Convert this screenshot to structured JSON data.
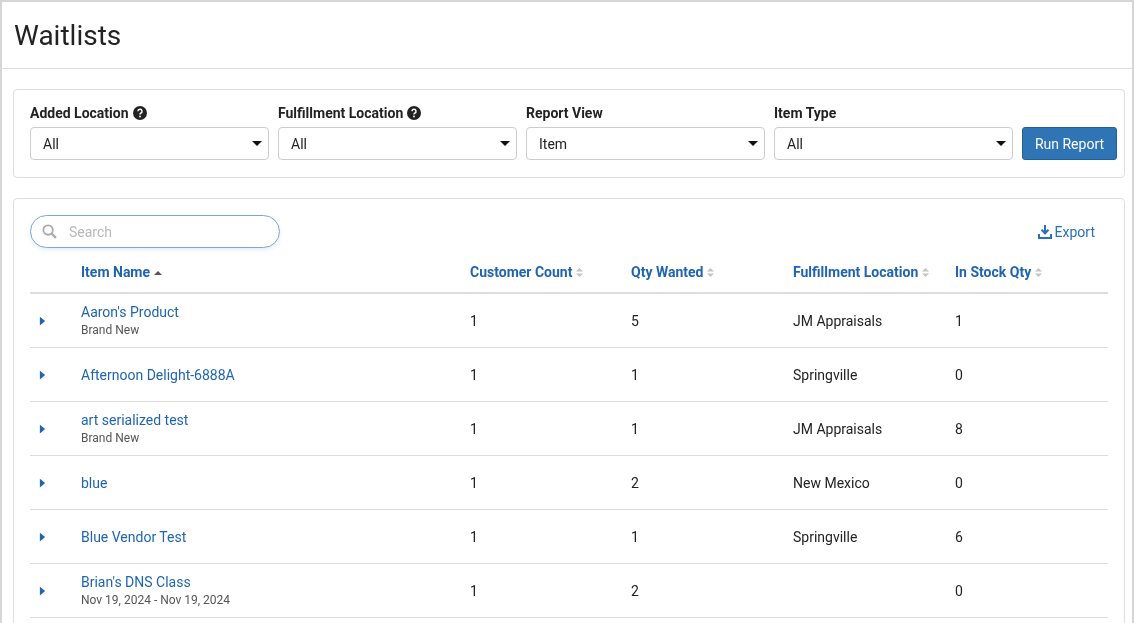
{
  "page": {
    "title": "Waitlists"
  },
  "filters": [
    {
      "label": "Added Location",
      "help": true,
      "value": "All"
    },
    {
      "label": "Fulfillment Location",
      "help": true,
      "value": "All"
    },
    {
      "label": "Report View",
      "help": false,
      "value": "Item"
    },
    {
      "label": "Item Type",
      "help": false,
      "value": "All"
    }
  ],
  "run_button": "Run Report",
  "search": {
    "placeholder": "Search"
  },
  "export": "Export",
  "table": {
    "columns": [
      {
        "label": "Item Name",
        "sorted": true
      },
      {
        "label": "Customer Count",
        "sorted": false
      },
      {
        "label": "Qty Wanted",
        "sorted": false
      },
      {
        "label": "Fulfillment Location",
        "sorted": false
      },
      {
        "label": "In Stock Qty",
        "sorted": false
      }
    ],
    "rows": [
      {
        "expanded": false,
        "name": "Aaron's Product",
        "detail": "Brand New",
        "customer_count": "1",
        "qty_wanted": "5",
        "fulfillment_location": "JM Appraisals",
        "in_stock_qty": "1"
      },
      {
        "expanded": false,
        "name": "Afternoon Delight-6888A",
        "customer_count": "1",
        "qty_wanted": "1",
        "fulfillment_location": "Springville",
        "in_stock_qty": "0"
      },
      {
        "expanded": false,
        "name": "art serialized test",
        "detail": "Brand New",
        "customer_count": "1",
        "qty_wanted": "1",
        "fulfillment_location": "JM Appraisals",
        "in_stock_qty": "8"
      },
      {
        "expanded": false,
        "name": "blue",
        "customer_count": "1",
        "qty_wanted": "2",
        "fulfillment_location": "New Mexico",
        "in_stock_qty": "0"
      },
      {
        "expanded": false,
        "name": "Blue Vendor Test",
        "customer_count": "1",
        "qty_wanted": "1",
        "fulfillment_location": "Springville",
        "in_stock_qty": "6"
      },
      {
        "expanded": false,
        "name": "Brian's DNS Class",
        "detail": "Nov 19, 2024 - Nov 19, 2024",
        "customer_count": "1",
        "qty_wanted": "2",
        "in_stock_qty": "0"
      }
    ]
  }
}
